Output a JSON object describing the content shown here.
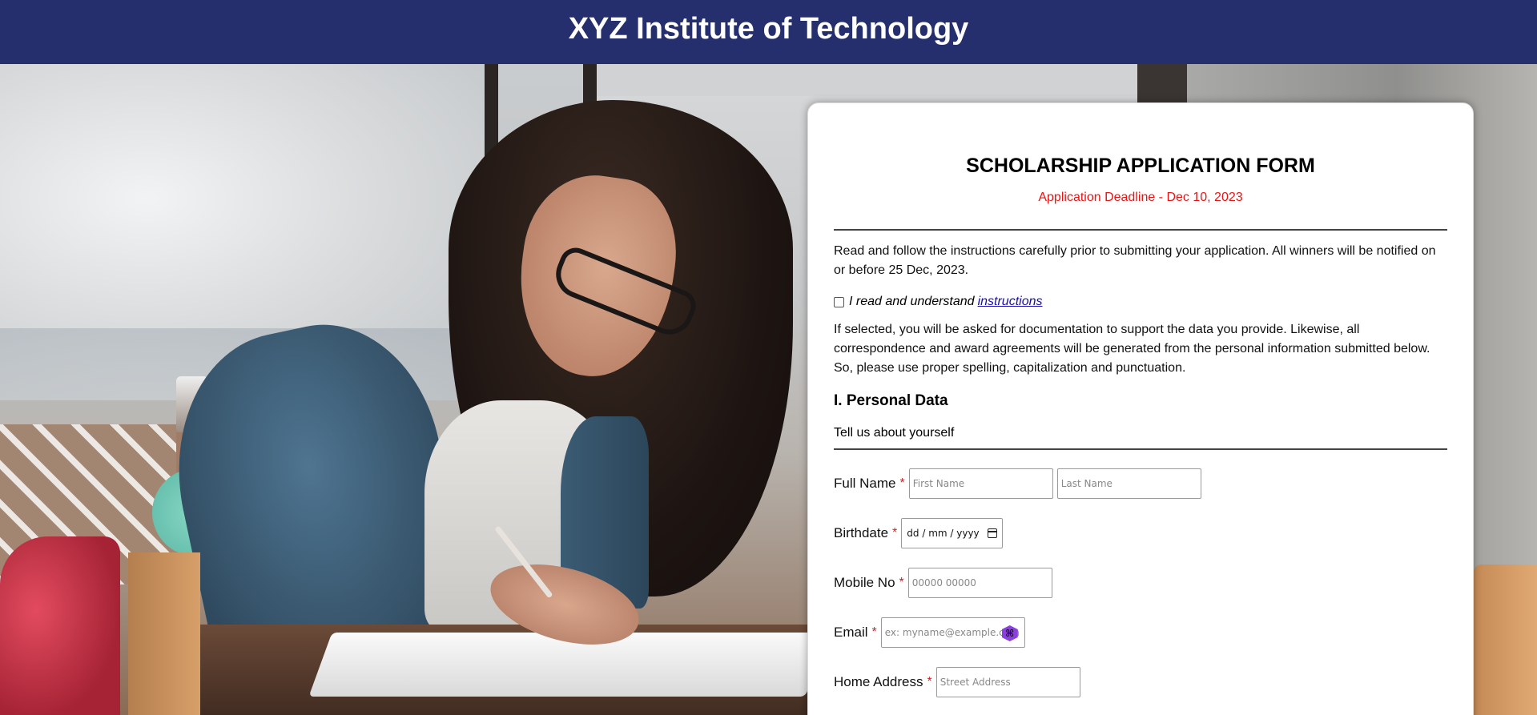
{
  "header": {
    "title": "XYZ Institute of Technology"
  },
  "form": {
    "title": "SCHOLARSHIP APPLICATION FORM",
    "deadline": "Application Deadline - Dec 10, 2023",
    "intro": "Read and follow the instructions carefully prior to submitting your application. All winners will be notified on or before 25 Dec, 2023.",
    "checkbox": {
      "label": "I read and understand",
      "link_text": "instructions",
      "checked": false
    },
    "notice": "If selected, you will be asked for documentation to support the data you provide. Likewise, all correspondence and award agreements will be generated from the personal information submitted below. So, please use proper spelling, capitalization and punctuation.",
    "section_title": "I. Personal Data",
    "section_subtitle": "Tell us about yourself",
    "required_mark": "*",
    "fields": {
      "full_name": {
        "label": "Full Name",
        "first_placeholder": "First Name",
        "last_placeholder": "Last Name"
      },
      "birthdate": {
        "label": "Birthdate",
        "placeholder": "dd / mm / yyyy"
      },
      "mobile": {
        "label": "Mobile No",
        "placeholder": "00000 00000"
      },
      "email": {
        "label": "Email",
        "placeholder": "ex: myname@example.com"
      },
      "home_address": {
        "label": "Home Address",
        "placeholder": "Street Address"
      }
    }
  },
  "colors": {
    "header_bg": "#262f6d",
    "deadline": "#e81414",
    "link": "#1a0dab",
    "extension_icon": "#8b3fe0"
  },
  "icons": {
    "date_picker": "calendar-icon",
    "email_extension": "extension-icon"
  }
}
